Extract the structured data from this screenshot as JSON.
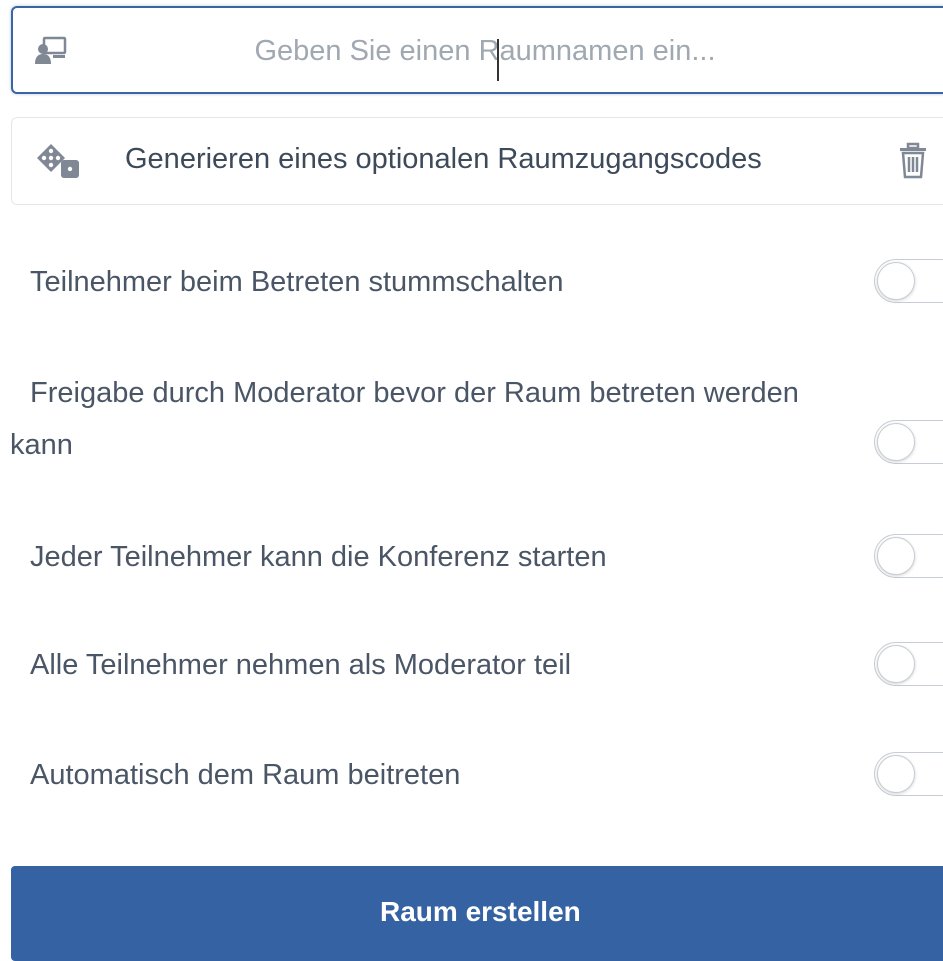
{
  "room_name_input": {
    "icon": "room-presentation-icon",
    "placeholder": "Geben Sie einen Raumnamen ein...",
    "value": ""
  },
  "access_code": {
    "icon": "dice-icon",
    "label": "Generieren eines optionalen Raumzugangscodes",
    "delete_icon": "trash-icon"
  },
  "options": [
    {
      "label": "Teilnehmer beim Betreten stummschalten",
      "enabled": false
    },
    {
      "label_line1": "Freigabe durch Moderator bevor der Raum betreten werden",
      "label_line2": "kann",
      "enabled": false
    },
    {
      "label": "Jeder Teilnehmer kann die Konferenz starten",
      "enabled": false
    },
    {
      "label": "Alle Teilnehmer nehmen als Moderator teil",
      "enabled": false
    },
    {
      "label": "Automatisch dem Raum beitreten",
      "enabled": false
    }
  ],
  "create_button": {
    "label": "Raum erstellen"
  },
  "colors": {
    "accent": "#3462a3",
    "input_border": "#3c64a0",
    "text": "#4a5666",
    "placeholder": "#a0a8b2"
  }
}
